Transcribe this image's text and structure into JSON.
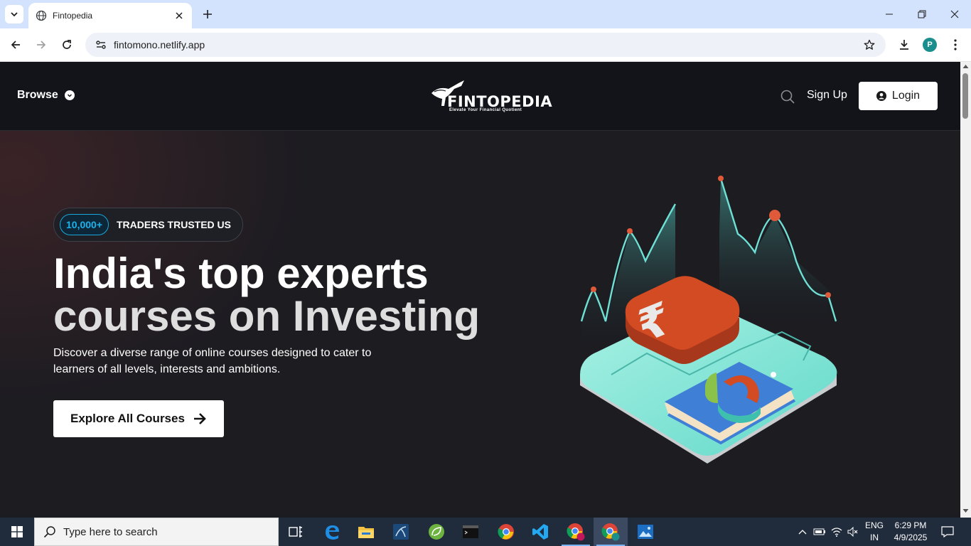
{
  "browser": {
    "tab_title": "Fintopedia",
    "url": "fintomono.netlify.app",
    "profile_initial": "P"
  },
  "header": {
    "browse_label": "Browse",
    "logo_brand": "FINTOPEDIA",
    "logo_tagline": "Elevate Your Financial Quotient",
    "signup_label": "Sign Up",
    "login_label": "Login"
  },
  "hero": {
    "badge_count": "10,000+",
    "badge_text": "TRADERS TRUSTED US",
    "headline_line1": "India's top experts",
    "headline_line2": "courses on Investing",
    "subtext": "Discover a diverse range of online courses designed to cater to learners of all levels, interests and ambitions.",
    "cta_label": "Explore All Courses"
  },
  "taskbar": {
    "search_placeholder": "Type here to search",
    "language_line1": "ENG",
    "language_line2": "IN",
    "time": "6:29 PM",
    "date": "4/9/2025",
    "apps": [
      "task-view",
      "edge",
      "file-explorer",
      "mysql-workbench",
      "spring-tools",
      "terminal",
      "chrome",
      "vscode",
      "chrome-profile",
      "chrome-profile-active",
      "photos"
    ]
  },
  "colors": {
    "badge_accent": "#1ab3ec",
    "header_bg": "#121419",
    "page_bg": "#1c1c21",
    "rupee_tile": "#d24b22",
    "platform": "#8ce8d8"
  }
}
